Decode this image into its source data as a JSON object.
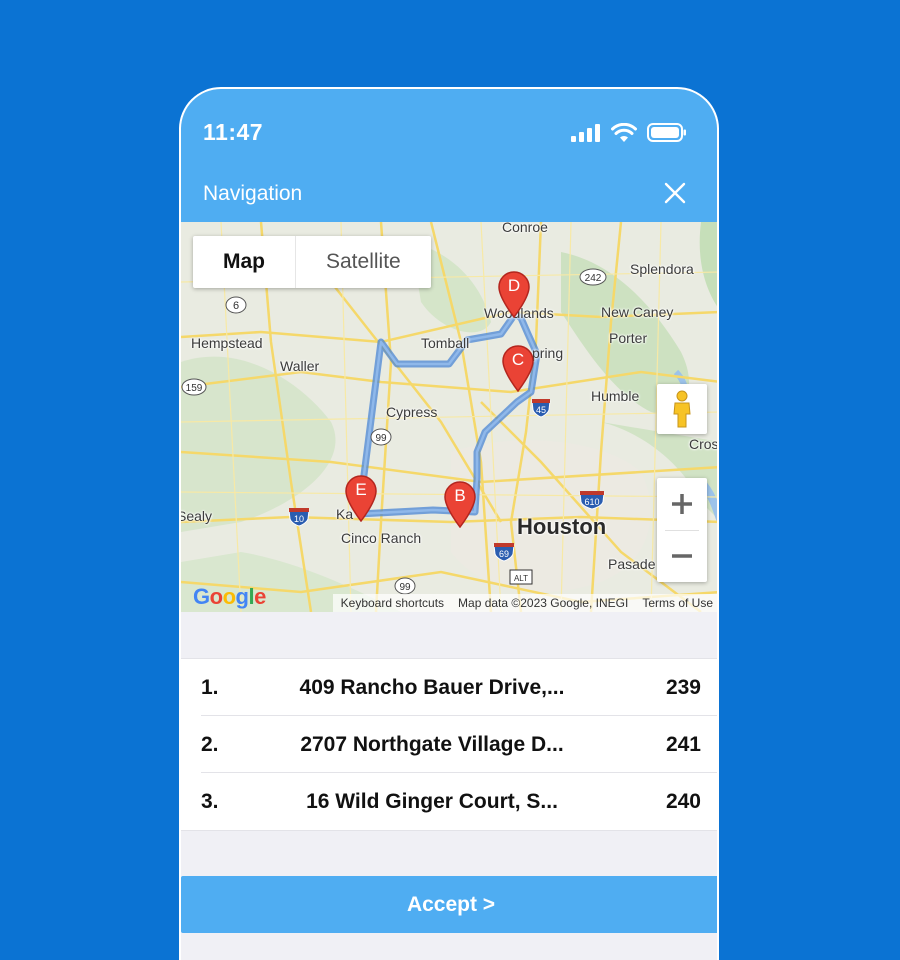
{
  "status_bar": {
    "time": "11:47"
  },
  "header": {
    "title": "Navigation"
  },
  "map": {
    "type_control": {
      "map_label": "Map",
      "satellite_label": "Satellite"
    },
    "labels": {
      "conroe": "Conroe",
      "splendora": "Splendora",
      "woodlands": "Woodlands",
      "new_caney": "New Caney",
      "hempstead": "Hempstead",
      "tomball": "Tomball",
      "spring": "pring",
      "porter": "Porter",
      "waller": "Waller",
      "humble": "Humble",
      "cypress": "Cypress",
      "crosby": "Cros",
      "houston": "Houston",
      "sealy": "Sealy",
      "katy": "Ka",
      "cinco_ranch": "Cinco Ranch",
      "pasadena": "Pasade"
    },
    "road_shields": [
      "6",
      "159",
      "242",
      "45",
      "99",
      "10",
      "610",
      "69",
      "ALT",
      "99"
    ],
    "markers": [
      "D",
      "C",
      "E",
      "B"
    ],
    "attribution": {
      "shortcuts": "Keyboard shortcuts",
      "data": "Map data ©2023 Google, INEGI",
      "terms": "Terms of Use"
    },
    "logo": "Google"
  },
  "routes": [
    {
      "index": "1.",
      "address": "409 Rancho Bauer Drive,...",
      "value": "239"
    },
    {
      "index": "2.",
      "address": "2707 Northgate Village D...",
      "value": "241"
    },
    {
      "index": "3.",
      "address": "16 Wild Ginger Court, S...",
      "value": "240"
    }
  ],
  "accept_button": {
    "label": "Accept >"
  }
}
